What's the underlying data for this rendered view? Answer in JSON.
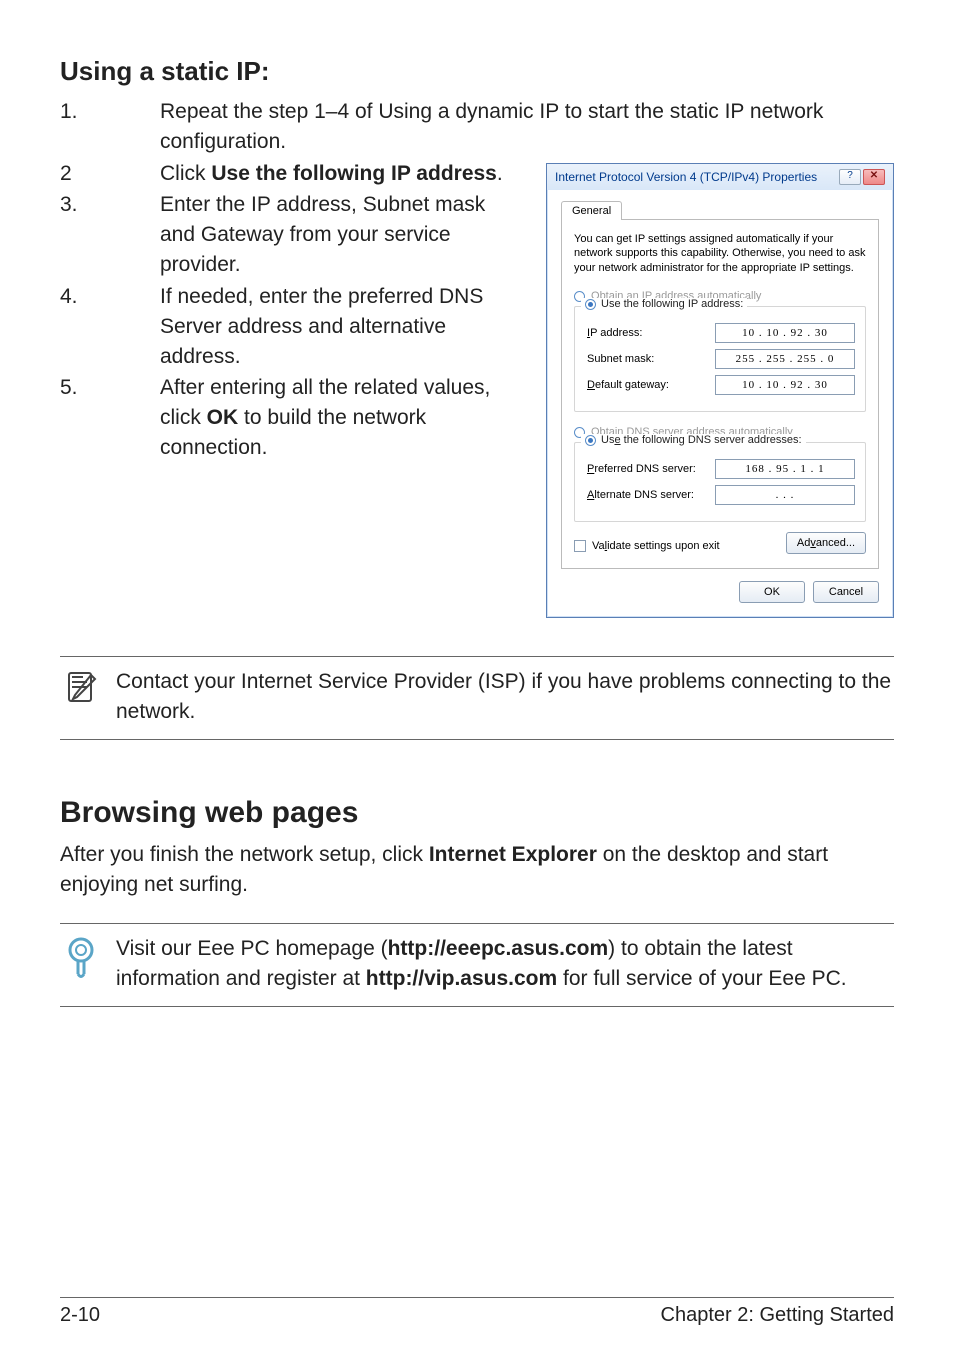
{
  "headings": {
    "using_static_ip": "Using a static IP:"
  },
  "steps": {
    "s1": {
      "num": "1.",
      "text": "Repeat the step 1–4 of Using a dynamic IP to start the static IP network configuration."
    },
    "s2": {
      "num": "2",
      "text_pre": "Click ",
      "bold": "Use the following IP address",
      "text_post": "."
    },
    "s3": {
      "num": "3.",
      "text": "Enter the IP address, Subnet mask and Gateway from your service provider."
    },
    "s4": {
      "num": "4.",
      "text": "If needed, enter the preferred DNS Server address and alternative address."
    },
    "s5": {
      "num": "5.",
      "text_pre": "After entering all the related values, click ",
      "bold": "OK",
      "text_post": " to build the network connection."
    }
  },
  "note1": "Contact your Internet Service Provider (ISP) if you have problems connecting to the network.",
  "section2": {
    "heading": "Browsing web pages",
    "para_pre": "After you finish the network setup, click ",
    "para_bold": "Internet Explorer",
    "para_post": " on the desktop and start enjoying net surfing."
  },
  "tip": {
    "pre": "Visit our Eee PC homepage (",
    "url1": "http://eeepc.asus.com",
    "mid": ") to obtain the latest information and register at ",
    "url2": "http://vip.asus.com",
    "post": " for full service of your Eee PC."
  },
  "footer": {
    "left": "2-10",
    "right": "Chapter 2: Getting Started"
  },
  "dialog": {
    "title": "Internet Protocol Version 4 (TCP/IPv4) Properties",
    "help_btn": "?",
    "close_btn": "✕",
    "tab_general": "General",
    "desc": "You can get IP settings assigned automatically if your network supports this capability. Otherwise, you need to ask your network administrator for the appropriate IP settings.",
    "opt_obtain_ip_pre": "O",
    "opt_obtain_ip": "btain an IP address automatically",
    "opt_use_ip": "e the following IP address:",
    "opt_use_ip_pre": "Us",
    "ip_label_pre": "I",
    "ip_label": "P address:",
    "ip_value": "10 . 10 . 92 . 30",
    "subnet_label": "bnet mask:",
    "subnet_pre": "Su",
    "subnet_value": "255 . 255 . 255 . 0",
    "gw_pre": "D",
    "gw_label": "efault gateway:",
    "gw_value": "10 . 10 . 92 . 30",
    "opt_obtain_dns": "tain DNS server address automatically",
    "opt_obtain_dns_pre": "Ob",
    "opt_use_dns_pre": "Use th",
    "opt_use_dns": " the following DNS server addresses:",
    "opt_use_dns_u": "e",
    "pdns_pre": "P",
    "pdns_label": "referred DNS server:",
    "pdns_value": "168 . 95 .  1  .  1",
    "adns_pre": "A",
    "adns_label": "lternate DNS server:",
    "adns_value": ".       .       .",
    "validate_pre": "Va",
    "validate_u": "l",
    "validate": "idate settings upon exit",
    "adv_pre": "Ad",
    "adv_u": "v",
    "advanced": "anced...",
    "ok": "OK",
    "cancel": "Cancel"
  }
}
